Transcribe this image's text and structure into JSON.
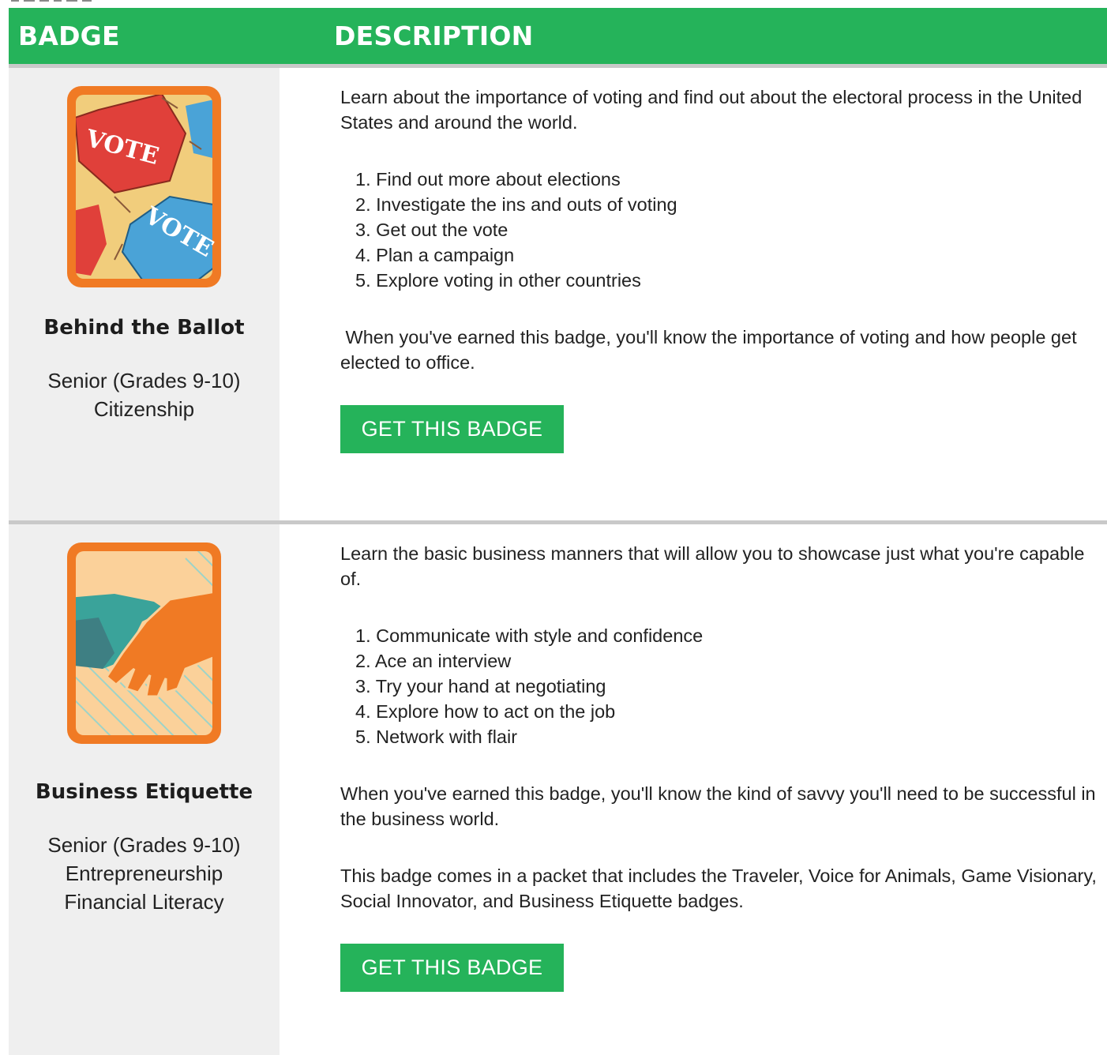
{
  "colors": {
    "header_green": "#25b35a",
    "button_green": "#25b35a",
    "badge_cell_bg": "#efefef",
    "divider": "#c9c9c9",
    "patch_border": "#f07a24"
  },
  "table": {
    "headers": {
      "badge": "BADGE",
      "description": "DESCRIPTION"
    }
  },
  "badges": [
    {
      "image_icon": "vote-buttons-icon",
      "image_text": "VOTE",
      "name": "Behind the Ballot",
      "level": "Senior (Grades 9-10)",
      "categories": [
        "Citizenship"
      ],
      "intro": "Learn about the importance of voting and find out about the electoral process in the United States and around the world.",
      "steps": [
        "Find out more about elections",
        "Investigate the ins and outs of voting",
        "Get out the vote",
        "Plan a campaign",
        "Explore voting in other countries"
      ],
      "outcome": " When you've earned this badge, you'll know the importance of voting and how people get elected to office.",
      "button_label": "GET THIS BADGE"
    },
    {
      "image_icon": "handshake-icon",
      "name": "Business Etiquette",
      "level": "Senior (Grades 9-10)",
      "categories": [
        "Entrepreneurship",
        "Financial Literacy"
      ],
      "intro": "Learn the basic business manners that will allow you to showcase just what you're capable of.",
      "steps": [
        "Communicate with style and confidence",
        "Ace an interview",
        "Try your hand at negotiating",
        "Explore how to act on the job",
        "Network with flair"
      ],
      "outcome": "When you've earned this badge, you'll know the kind of savvy you'll need to be successful in the business world.",
      "packet_note": "This badge comes in a packet that includes the Traveler, Voice for Animals, Game Visionary, Social Innovator, and Business Etiquette badges.",
      "button_label": "GET THIS BADGE"
    }
  ]
}
